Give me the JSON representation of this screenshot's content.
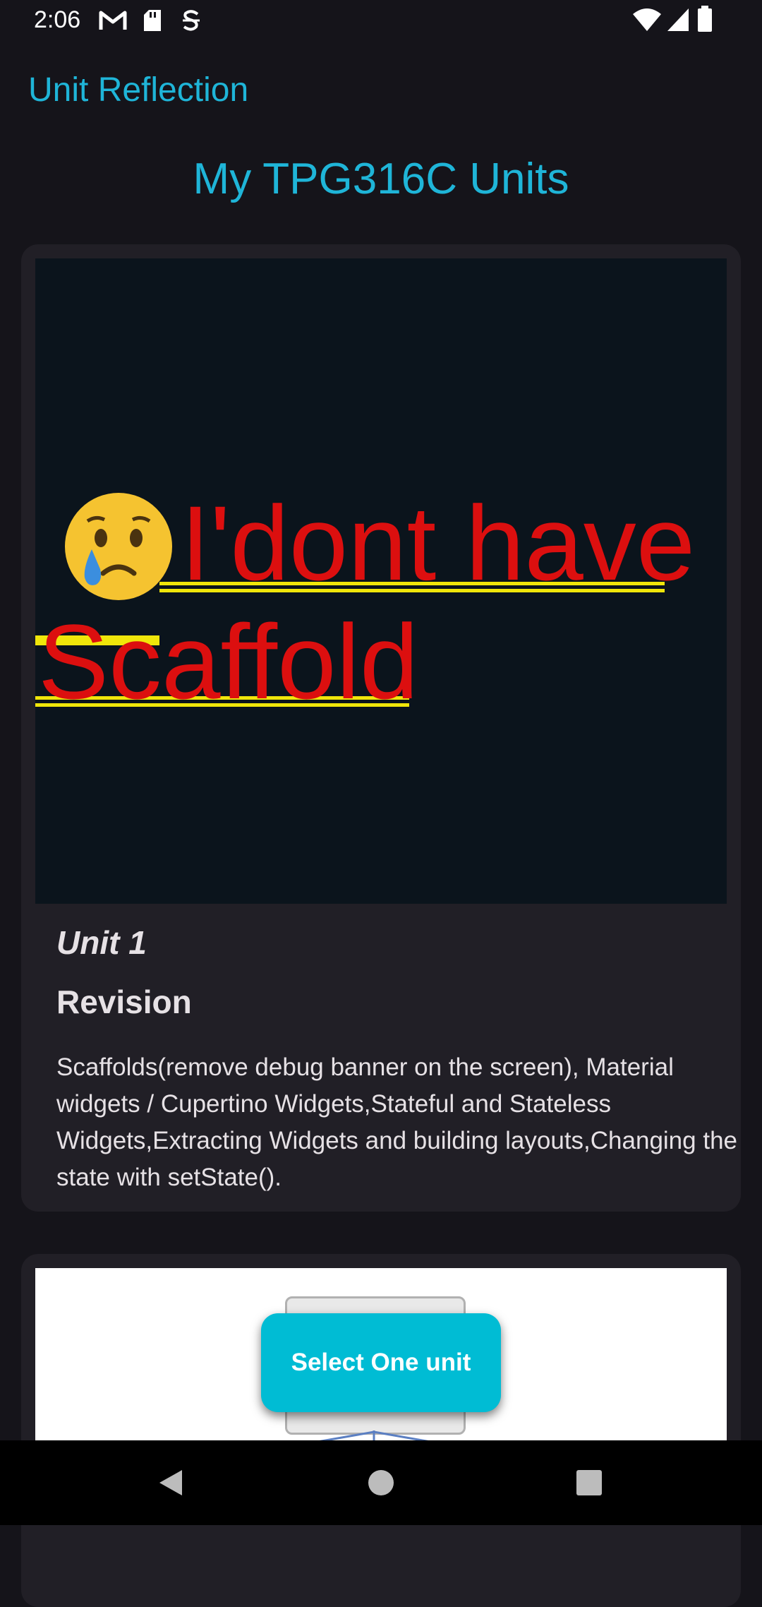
{
  "status_bar": {
    "time": "2:06",
    "icons_left": [
      "gmail-icon",
      "sd-card-icon",
      "s-icon"
    ],
    "icons_right": [
      "wifi-icon",
      "signal-icon",
      "battery-icon"
    ]
  },
  "app_bar": {
    "title": "Unit Reflection"
  },
  "page": {
    "title": "My TPG316C Units"
  },
  "cards": [
    {
      "image_text_line1": "I'dont have",
      "image_text_line2": "Scaffold",
      "image_emoji": "crying-face",
      "title": "Unit 1",
      "subtitle": "Revision",
      "description": "Scaffolds(remove debug banner on the screen), Material widgets / Cupertino Widgets,Stateful and Stateless Widgets,Extracting Widgets and building layouts,Changing the state with setState()."
    }
  ],
  "fab": {
    "label": "Select One unit"
  },
  "colors": {
    "background": "#15141a",
    "card": "#211f26",
    "accent": "#1fb5d8",
    "fab": "#00bcd4",
    "image_text": "#dc0f0f",
    "highlight": "#f0e60a"
  },
  "nav": {
    "back_icon": "back-triangle-icon",
    "home_icon": "home-circle-icon",
    "recents_icon": "recents-square-icon"
  }
}
